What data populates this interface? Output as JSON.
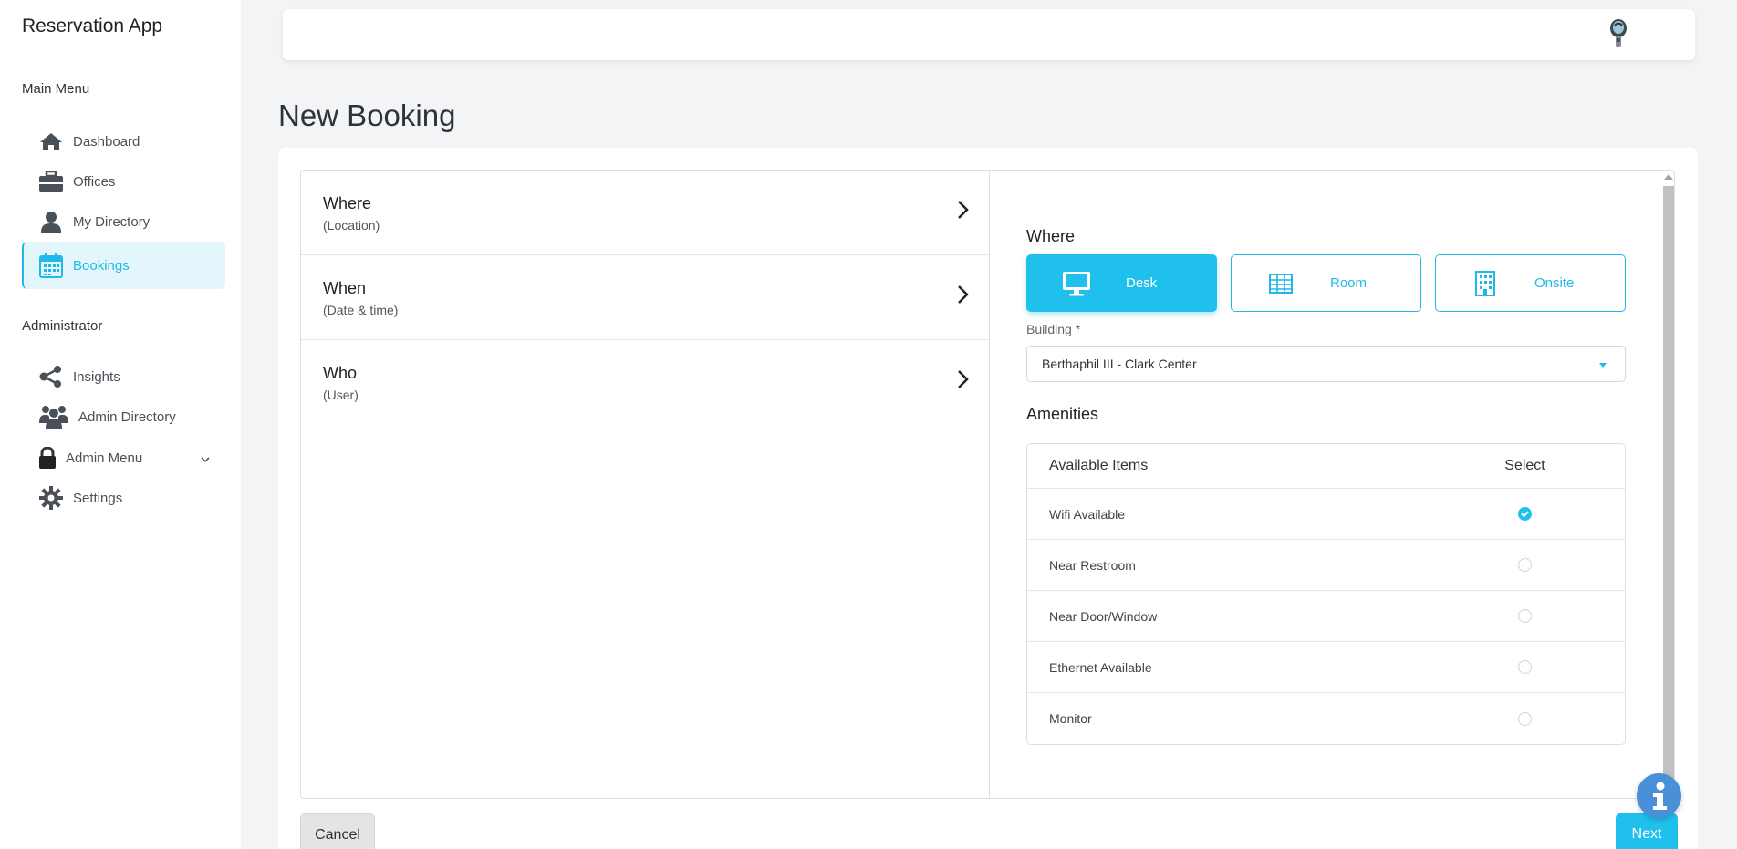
{
  "app": {
    "title": "Reservation App"
  },
  "sidebar": {
    "main_menu_label": "Main Menu",
    "admin_label": "Administrator",
    "main_items": [
      {
        "label": "Dashboard",
        "icon": "home-icon"
      },
      {
        "label": "Offices",
        "icon": "briefcase-icon"
      },
      {
        "label": "My Directory",
        "icon": "user-icon"
      },
      {
        "label": "Bookings",
        "icon": "calendar-icon",
        "active": true
      }
    ],
    "admin_items": [
      {
        "label": "Insights",
        "icon": "share-icon"
      },
      {
        "label": "Admin Directory",
        "icon": "users-icon"
      },
      {
        "label": "Admin Menu",
        "icon": "lock-icon",
        "expandable": true
      },
      {
        "label": "Settings",
        "icon": "gear-icon"
      }
    ]
  },
  "page": {
    "title": "New Booking"
  },
  "steps": [
    {
      "title": "Where",
      "subtitle": "(Location)"
    },
    {
      "title": "When",
      "subtitle": "(Date & time)"
    },
    {
      "title": "Who",
      "subtitle": "(User)"
    }
  ],
  "where": {
    "heading": "Where",
    "types": [
      {
        "label": "Desk",
        "icon": "monitor-icon",
        "selected": true
      },
      {
        "label": "Room",
        "icon": "grid-icon",
        "selected": false
      },
      {
        "label": "Onsite",
        "icon": "building-icon",
        "selected": false
      }
    ],
    "building_label": "Building *",
    "building_value": "Berthaphil III - Clark Center"
  },
  "amenities": {
    "heading": "Amenities",
    "col_item": "Available Items",
    "col_select": "Select",
    "rows": [
      {
        "label": "Wifi Available",
        "checked": true
      },
      {
        "label": "Near Restroom",
        "checked": false
      },
      {
        "label": "Near Door/Window",
        "checked": false
      },
      {
        "label": "Ethernet Available",
        "checked": false
      },
      {
        "label": "Monitor",
        "checked": false
      }
    ]
  },
  "actions": {
    "cancel": "Cancel",
    "next": "Next"
  },
  "colors": {
    "accent": "#1fc0ec",
    "info": "#4a90d9"
  }
}
